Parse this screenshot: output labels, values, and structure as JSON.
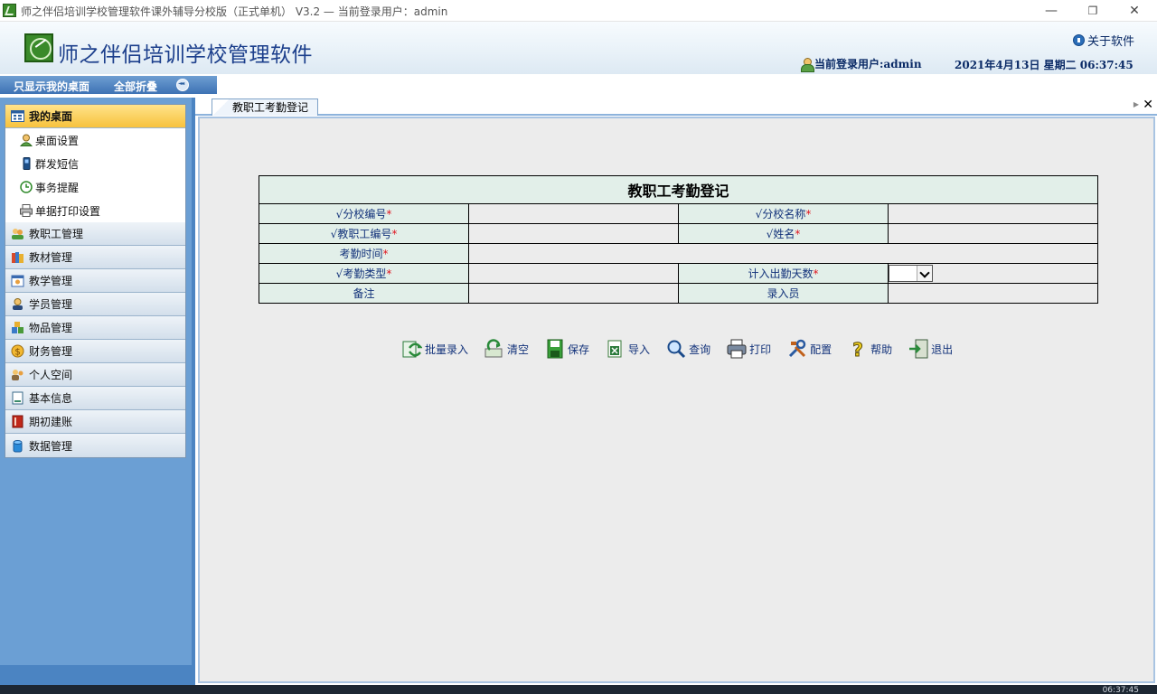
{
  "window": {
    "title": "师之伴侣培训学校管理软件课外辅导分校版（正式单机） V3.2 —  当前登录用户：admin",
    "minimize": "—",
    "restore": "❐",
    "close": "✕"
  },
  "header": {
    "app_name": "师之伴侣培训学校管理软件",
    "about": "关于软件",
    "user_label": "当前登录用户:",
    "user_name": "admin",
    "datetime": "2021年4月13日  星期二  06:37:45"
  },
  "subbar": {
    "show_mine": "只显示我的桌面",
    "collapse_all": "全部折叠"
  },
  "sidebar": {
    "active_group": {
      "label": "我的桌面",
      "icon": "desktop-icon",
      "items": [
        {
          "label": "桌面设置",
          "icon": "user-icon"
        },
        {
          "label": "群发短信",
          "icon": "phone-icon"
        },
        {
          "label": "事务提醒",
          "icon": "clock-icon"
        },
        {
          "label": "单据打印设置",
          "icon": "printer-icon"
        }
      ]
    },
    "groups": [
      {
        "label": "教职工管理",
        "icon": "staff-icon"
      },
      {
        "label": "教材管理",
        "icon": "books-icon"
      },
      {
        "label": "教学管理",
        "icon": "teaching-icon"
      },
      {
        "label": "学员管理",
        "icon": "student-icon"
      },
      {
        "label": "物品管理",
        "icon": "goods-icon"
      },
      {
        "label": "财务管理",
        "icon": "finance-icon"
      },
      {
        "label": "个人空间",
        "icon": "personal-icon"
      },
      {
        "label": "基本信息",
        "icon": "document-icon"
      },
      {
        "label": "期初建账",
        "icon": "ledger-icon"
      },
      {
        "label": "数据管理",
        "icon": "database-icon"
      }
    ]
  },
  "tabs": [
    {
      "label": "教职工考勤登记"
    }
  ],
  "tab_close": "✕",
  "form": {
    "title": "教职工考勤登记",
    "required_mark": "*",
    "labels": {
      "branch_code": "√分校编号",
      "branch_name": "√分校名称",
      "staff_code": "√教职工编号",
      "name": "√姓名",
      "attendance_time": "考勤时间",
      "attendance_type": "√考勤类型",
      "attendance_days": "计入出勤天数",
      "remark": "备注",
      "operator": "录入员"
    }
  },
  "actions": [
    {
      "label": "批量录入",
      "icon": "batch-entry-icon"
    },
    {
      "label": "清空",
      "icon": "clear-icon"
    },
    {
      "label": "保存",
      "icon": "save-icon"
    },
    {
      "label": "导入",
      "icon": "import-icon"
    },
    {
      "label": "查询",
      "icon": "search-icon"
    },
    {
      "label": "打印",
      "icon": "print-icon"
    },
    {
      "label": "配置",
      "icon": "config-icon"
    },
    {
      "label": "帮助",
      "icon": "help-icon"
    },
    {
      "label": "退出",
      "icon": "exit-icon"
    }
  ],
  "status": {
    "clock": "06:37:45"
  }
}
